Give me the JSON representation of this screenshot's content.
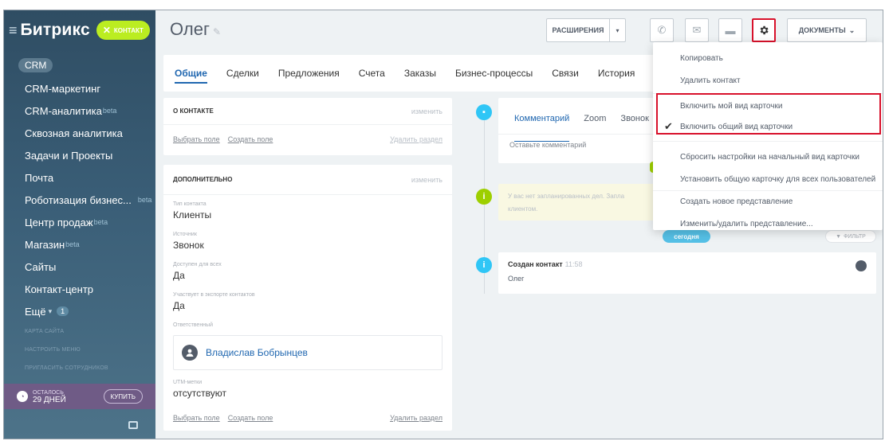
{
  "sidebar": {
    "brand": "Битрикс",
    "contact_button": "контакт",
    "items": [
      {
        "label": "CRM",
        "sup": "",
        "active": true
      },
      {
        "label": "CRM-маркетинг",
        "sup": ""
      },
      {
        "label": "CRM-аналитика",
        "sup": "beta"
      },
      {
        "label": "Сквозная аналитика",
        "sup": ""
      },
      {
        "label": "Задачи и Проекты",
        "sup": ""
      },
      {
        "label": "Почта",
        "sup": ""
      },
      {
        "label": "Роботизация бизнес...",
        "sup": "beta"
      },
      {
        "label": "Центр продаж",
        "sup": "beta"
      },
      {
        "label": "Магазин",
        "sup": "beta"
      },
      {
        "label": "Сайты",
        "sup": ""
      },
      {
        "label": "Контакт-центр",
        "sup": ""
      },
      {
        "label": "Ещё",
        "sup": "",
        "badge": "1"
      }
    ],
    "small_links": [
      "Карта сайта",
      "Настроить меню",
      "Пригласить сотрудников"
    ],
    "trial": {
      "caption": "осталось",
      "days": "29 дней",
      "buy": "купить"
    }
  },
  "header": {
    "title": "Олег",
    "extensions": "Расширения",
    "documents": "Документы"
  },
  "tabs": [
    "Общие",
    "Сделки",
    "Предложения",
    "Счета",
    "Заказы",
    "Бизнес-процессы",
    "Связи",
    "История"
  ],
  "about": {
    "title": "О контакте",
    "edit": "изменить",
    "select_field": "Выбрать поле",
    "create_field": "Создать поле",
    "delete_section": "Удалить раздел"
  },
  "extra": {
    "title": "Дополнительно",
    "edit": "изменить",
    "fields": [
      {
        "label": "Тип контакта",
        "value": "Клиенты"
      },
      {
        "label": "Источник",
        "value": "Звонок"
      },
      {
        "label": "Доступен для всех",
        "value": "Да"
      },
      {
        "label": "Участвует в экспорте контактов",
        "value": "Да"
      }
    ],
    "responsible_label": "Ответственный",
    "responsible_name": "Владислав Бобрынцев",
    "utm_label": "UTM-метки",
    "utm_value": "отсутствуют",
    "select_field": "Выбрать поле",
    "create_field": "Создать поле",
    "delete_section": "Удалить раздел"
  },
  "timeline": {
    "tabs": [
      "Комментарий",
      "Zoom",
      "Звонок"
    ],
    "comment_placeholder": "Оставьте комментарий",
    "plan_text_1": "У вас нет запланированных дел. Запла",
    "plan_text_2": "клиентом.",
    "today": "сегодня",
    "filter": "фильтр",
    "event_title": "Создан контакт",
    "event_time": "11:58",
    "event_name": "Олег"
  },
  "menu": {
    "items": [
      {
        "label": "Копировать",
        "checked": false
      },
      {
        "label": "Удалить контакт",
        "checked": false
      },
      {
        "label": "Включить мой вид карточки",
        "checked": false
      },
      {
        "label": "Включить общий вид карточки",
        "checked": true
      },
      {
        "label": "Сбросить настройки на начальный вид карточки",
        "checked": false
      },
      {
        "label": "Установить общую карточку для всех пользователей",
        "checked": false
      },
      {
        "label": "Создать новое представление",
        "checked": false
      },
      {
        "label": "Изменить/удалить представление...",
        "checked": false
      }
    ]
  },
  "colors": {
    "accent": "#2067b0",
    "highlight": "#d8112b",
    "contact_button": "#bbed21",
    "today": "#55c0e6",
    "info": "#2fc6f6",
    "plan": "#9dcf00"
  }
}
